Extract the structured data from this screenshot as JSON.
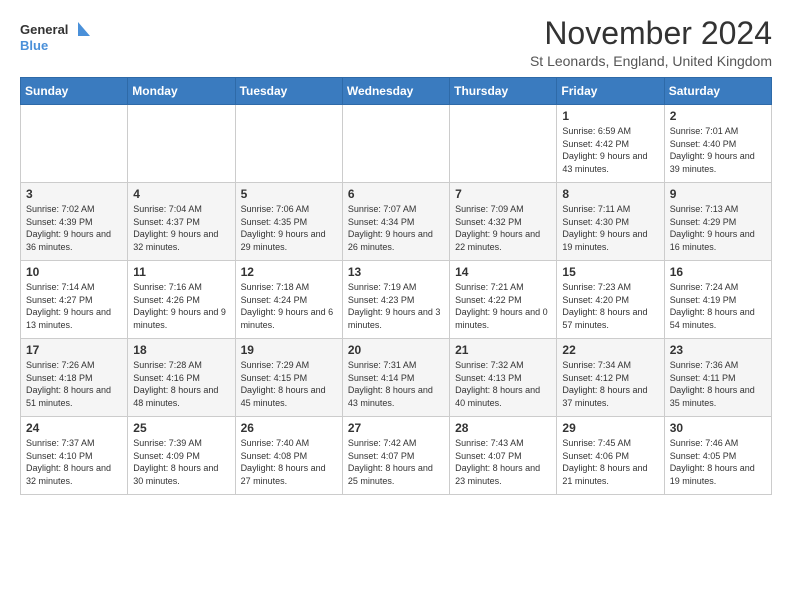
{
  "header": {
    "logo_general": "General",
    "logo_blue": "Blue",
    "month_title": "November 2024",
    "location": "St Leonards, England, United Kingdom"
  },
  "weekdays": [
    "Sunday",
    "Monday",
    "Tuesday",
    "Wednesday",
    "Thursday",
    "Friday",
    "Saturday"
  ],
  "weeks": [
    [
      {
        "day": "",
        "info": ""
      },
      {
        "day": "",
        "info": ""
      },
      {
        "day": "",
        "info": ""
      },
      {
        "day": "",
        "info": ""
      },
      {
        "day": "",
        "info": ""
      },
      {
        "day": "1",
        "info": "Sunrise: 6:59 AM\nSunset: 4:42 PM\nDaylight: 9 hours and 43 minutes."
      },
      {
        "day": "2",
        "info": "Sunrise: 7:01 AM\nSunset: 4:40 PM\nDaylight: 9 hours and 39 minutes."
      }
    ],
    [
      {
        "day": "3",
        "info": "Sunrise: 7:02 AM\nSunset: 4:39 PM\nDaylight: 9 hours and 36 minutes."
      },
      {
        "day": "4",
        "info": "Sunrise: 7:04 AM\nSunset: 4:37 PM\nDaylight: 9 hours and 32 minutes."
      },
      {
        "day": "5",
        "info": "Sunrise: 7:06 AM\nSunset: 4:35 PM\nDaylight: 9 hours and 29 minutes."
      },
      {
        "day": "6",
        "info": "Sunrise: 7:07 AM\nSunset: 4:34 PM\nDaylight: 9 hours and 26 minutes."
      },
      {
        "day": "7",
        "info": "Sunrise: 7:09 AM\nSunset: 4:32 PM\nDaylight: 9 hours and 22 minutes."
      },
      {
        "day": "8",
        "info": "Sunrise: 7:11 AM\nSunset: 4:30 PM\nDaylight: 9 hours and 19 minutes."
      },
      {
        "day": "9",
        "info": "Sunrise: 7:13 AM\nSunset: 4:29 PM\nDaylight: 9 hours and 16 minutes."
      }
    ],
    [
      {
        "day": "10",
        "info": "Sunrise: 7:14 AM\nSunset: 4:27 PM\nDaylight: 9 hours and 13 minutes."
      },
      {
        "day": "11",
        "info": "Sunrise: 7:16 AM\nSunset: 4:26 PM\nDaylight: 9 hours and 9 minutes."
      },
      {
        "day": "12",
        "info": "Sunrise: 7:18 AM\nSunset: 4:24 PM\nDaylight: 9 hours and 6 minutes."
      },
      {
        "day": "13",
        "info": "Sunrise: 7:19 AM\nSunset: 4:23 PM\nDaylight: 9 hours and 3 minutes."
      },
      {
        "day": "14",
        "info": "Sunrise: 7:21 AM\nSunset: 4:22 PM\nDaylight: 9 hours and 0 minutes."
      },
      {
        "day": "15",
        "info": "Sunrise: 7:23 AM\nSunset: 4:20 PM\nDaylight: 8 hours and 57 minutes."
      },
      {
        "day": "16",
        "info": "Sunrise: 7:24 AM\nSunset: 4:19 PM\nDaylight: 8 hours and 54 minutes."
      }
    ],
    [
      {
        "day": "17",
        "info": "Sunrise: 7:26 AM\nSunset: 4:18 PM\nDaylight: 8 hours and 51 minutes."
      },
      {
        "day": "18",
        "info": "Sunrise: 7:28 AM\nSunset: 4:16 PM\nDaylight: 8 hours and 48 minutes."
      },
      {
        "day": "19",
        "info": "Sunrise: 7:29 AM\nSunset: 4:15 PM\nDaylight: 8 hours and 45 minutes."
      },
      {
        "day": "20",
        "info": "Sunrise: 7:31 AM\nSunset: 4:14 PM\nDaylight: 8 hours and 43 minutes."
      },
      {
        "day": "21",
        "info": "Sunrise: 7:32 AM\nSunset: 4:13 PM\nDaylight: 8 hours and 40 minutes."
      },
      {
        "day": "22",
        "info": "Sunrise: 7:34 AM\nSunset: 4:12 PM\nDaylight: 8 hours and 37 minutes."
      },
      {
        "day": "23",
        "info": "Sunrise: 7:36 AM\nSunset: 4:11 PM\nDaylight: 8 hours and 35 minutes."
      }
    ],
    [
      {
        "day": "24",
        "info": "Sunrise: 7:37 AM\nSunset: 4:10 PM\nDaylight: 8 hours and 32 minutes."
      },
      {
        "day": "25",
        "info": "Sunrise: 7:39 AM\nSunset: 4:09 PM\nDaylight: 8 hours and 30 minutes."
      },
      {
        "day": "26",
        "info": "Sunrise: 7:40 AM\nSunset: 4:08 PM\nDaylight: 8 hours and 27 minutes."
      },
      {
        "day": "27",
        "info": "Sunrise: 7:42 AM\nSunset: 4:07 PM\nDaylight: 8 hours and 25 minutes."
      },
      {
        "day": "28",
        "info": "Sunrise: 7:43 AM\nSunset: 4:07 PM\nDaylight: 8 hours and 23 minutes."
      },
      {
        "day": "29",
        "info": "Sunrise: 7:45 AM\nSunset: 4:06 PM\nDaylight: 8 hours and 21 minutes."
      },
      {
        "day": "30",
        "info": "Sunrise: 7:46 AM\nSunset: 4:05 PM\nDaylight: 8 hours and 19 minutes."
      }
    ]
  ]
}
